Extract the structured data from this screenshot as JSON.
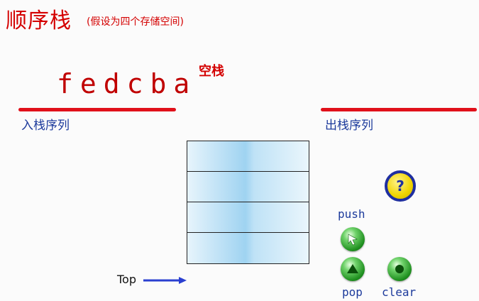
{
  "header": {
    "title": "顺序栈",
    "subtitle": "(假设为四个存储空间)"
  },
  "status": "空栈",
  "input_sequence": "fedcba",
  "labels": {
    "input": "入栈序列",
    "output": "出栈序列",
    "top": "Top"
  },
  "stack": {
    "capacity": 4,
    "cells": [
      "",
      "",
      "",
      ""
    ]
  },
  "buttons": {
    "help": "?",
    "push": "push",
    "pop": "pop",
    "clear": "clear"
  },
  "colors": {
    "title": "#d40000",
    "line": "#e0101a",
    "label": "#1d3b9c",
    "button_green": "#1f8f1f",
    "help_yellow": "#f0d400"
  },
  "icons": {
    "push": "push-arrow-icon",
    "pop": "pop-arrow-icon",
    "clear": "clear-dot-icon",
    "top": "right-arrow-icon"
  }
}
